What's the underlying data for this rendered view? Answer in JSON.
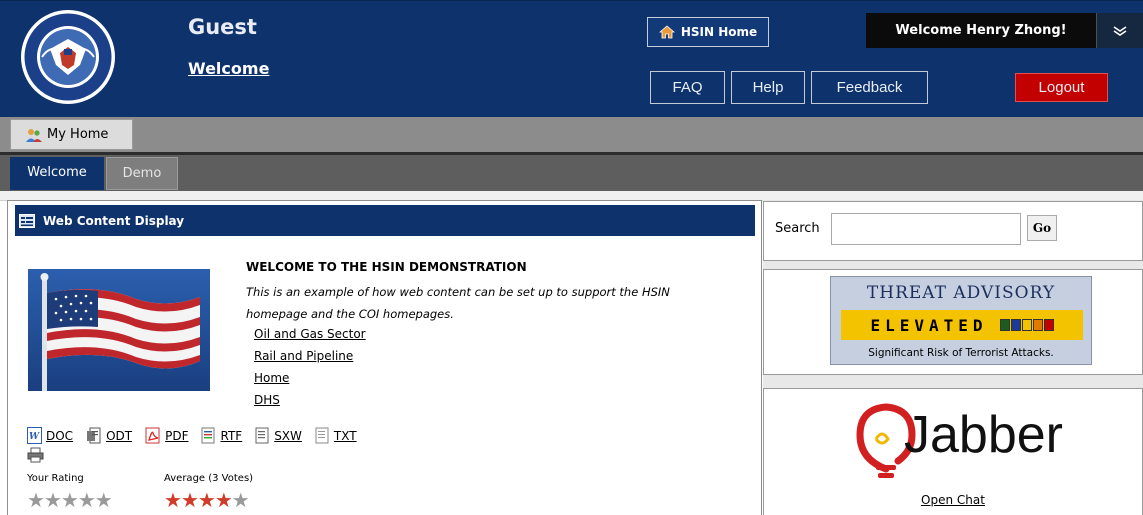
{
  "header": {
    "user_name": "Guest",
    "welcome_link": "Welcome",
    "hsin_home_label": "HSIN Home",
    "welcome_user": "Welcome Henry Zhong!",
    "faq_label": "FAQ",
    "help_label": "Help",
    "feedback_label": "Feedback",
    "logout_label": "Logout"
  },
  "nav": {
    "top_tab": "My Home",
    "subtabs": [
      "Welcome",
      "Demo"
    ]
  },
  "portlet": {
    "title": "Web Content Display",
    "content_title": "WELCOME TO THE HSIN DEMONSTRATION",
    "content_body": "This is an example of how web content can be set up to support the HSIN homepage and the COI homepages.",
    "links": [
      "Oil and Gas Sector",
      "Rail and Pipeline",
      "Home",
      "DHS"
    ],
    "downloads": [
      "DOC",
      "ODT",
      "PDF",
      "RTF",
      "SXW",
      "TXT"
    ],
    "your_rating_label": "Your Rating",
    "average_label": "Average (3 Votes)",
    "your_rating_stars": 0,
    "average_stars": 4,
    "star_max": 5
  },
  "search": {
    "label": "Search",
    "value": "",
    "go_label": "Go"
  },
  "threat": {
    "title": "THREAT ADVISORY",
    "level": "ELEVATED",
    "description": "Significant Risk of Terrorist Attacks.",
    "colors": [
      "#1f5a1f",
      "#1b3a9a",
      "#f3c300",
      "#e07a00",
      "#c60000"
    ]
  },
  "jabber": {
    "brand": "Jabber",
    "open_chat": "Open Chat"
  },
  "colors": {
    "header_bg": "#0e326c",
    "logout_bg": "#c30000",
    "threat_yellow": "#f3c300",
    "star_red": "#d03b2a",
    "star_grey": "#9a9a9a"
  }
}
